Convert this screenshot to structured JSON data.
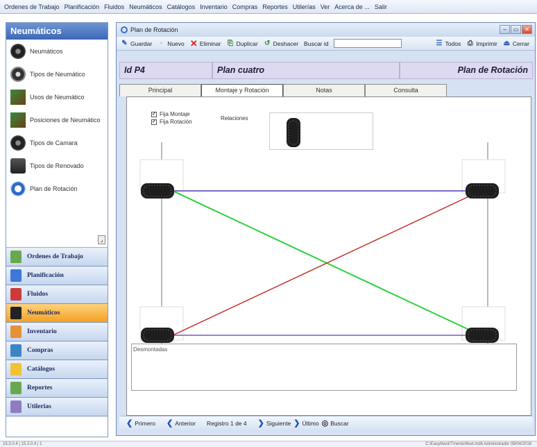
{
  "menu": [
    "Ordenes de Trabajo",
    "Planificación",
    "Fluidos",
    "Neumáticos",
    "Catálogos",
    "Inventario",
    "Compras",
    "Reportes",
    "Utilerías",
    "Ver",
    "Acerca de ...",
    "Salir"
  ],
  "sidebar": {
    "title": "Neumáticos",
    "items": [
      {
        "label": "Neumáticos",
        "icon": "tire-icon"
      },
      {
        "label": "Tipos de Neumático",
        "icon": "tire-type-icon"
      },
      {
        "label": "Usos de Neumático",
        "icon": "road-icon"
      },
      {
        "label": "Posiciones de Neumático",
        "icon": "truck-icon"
      },
      {
        "label": "Tipos de Camara",
        "icon": "inner-tube-icon"
      },
      {
        "label": "Tipos de Renovado",
        "icon": "retread-icon"
      },
      {
        "label": "Plan de Rotación",
        "icon": "rotation-plan-icon"
      }
    ],
    "scroll_glyph": "⌟"
  },
  "nav": [
    {
      "label": "Ordenes de Trabajo",
      "color": "#6aa84f"
    },
    {
      "label": "Planificación",
      "color": "#3c78d8"
    },
    {
      "label": "Fluidos",
      "color": "#cc3b3b"
    },
    {
      "label": "Neumáticos",
      "color": "#222222",
      "active": true
    },
    {
      "label": "Inventario",
      "color": "#e69138"
    },
    {
      "label": "Compras",
      "color": "#3d85c6"
    },
    {
      "label": "Catálogos",
      "color": "#f1c232"
    },
    {
      "label": "Reportes",
      "color": "#6aa84f"
    },
    {
      "label": "Utilerias",
      "color": "#8e7cc3"
    }
  ],
  "window": {
    "title": "Plan de Rotación",
    "controls": [
      "–",
      "▭",
      "✕"
    ]
  },
  "toolbar": {
    "save": "Guardar",
    "new": "Nuevo",
    "delete": "Eliminar",
    "duplicate": "Duplicar",
    "undo": "Deshacer",
    "search_label": "Buscar id",
    "search_value": "",
    "all": "Todos",
    "print": "Imprimir",
    "close": "Cerrar"
  },
  "header": {
    "id": "Id P4",
    "name": "Plan cuatro",
    "module": "Plan de Rotación"
  },
  "tabs": [
    "Principal",
    "Montaje y Rotación",
    "Notas",
    "Consulta"
  ],
  "active_tab": "Montaje y Rotación",
  "form": {
    "fix_mount": "Fija Montaje",
    "fix_rotation": "Fija Rotación",
    "fix_mount_checked": true,
    "fix_rotation_checked": true,
    "relations_label": "Relaciones",
    "unmounted_label": "Desmontadas"
  },
  "rotation_lines": [
    {
      "from": "front-left",
      "to": "front-right",
      "color": "#4b3bb8"
    },
    {
      "from": "front-left",
      "to": "rear-right",
      "color": "#2bd13a"
    },
    {
      "from": "rear-left",
      "to": "front-right",
      "color": "#c4302b"
    },
    {
      "from": "rear-left",
      "to": "rear-right",
      "color": "#7d55c4"
    }
  ],
  "nav_bottom": {
    "first": "Primero",
    "prev": "Anterior",
    "record": "Registro 1 de 4",
    "next": "Siguiente",
    "last": "Último",
    "search": "Buscar"
  },
  "status": {
    "left": "15.3.0.4 | 15.3.0.4 | 1",
    "right": "C:\\EasyMant\\Tmento\\fleet.mdb   Administrador   08/04/2018"
  }
}
